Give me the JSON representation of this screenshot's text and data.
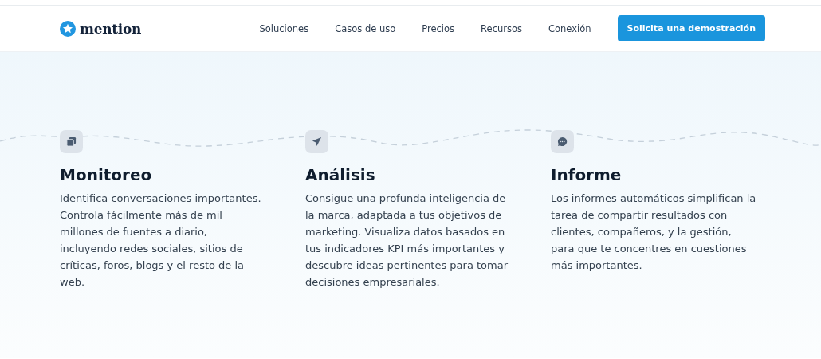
{
  "header": {
    "logo": "mention",
    "nav": [
      "Soluciones",
      "Casos de uso",
      "Precios",
      "Recursos",
      "Conexión"
    ],
    "cta": "Solicita una demostración"
  },
  "features": [
    {
      "title": "Monitoreo",
      "text": "Identifica conversaciones importantes. Controla fácilmente más de mil millones de fuentes a diario, incluyendo redes sociales, sitios de críticas, foros, blogs y el resto de la web."
    },
    {
      "title": "Análisis",
      "text": "Consigue una profunda inteligencia de la marca, adaptada a tus objetivos de marketing. Visualiza datos basados en tus indicadores KPI más importantes y descubre ideas pertinentes para tomar decisiones empresariales."
    },
    {
      "title": "Informe",
      "text": "Los informes automáticos simplifican la tarea de compartir resultados con clientes, compañeros, y la gestión, para que te concentres en cuestiones más importantes."
    }
  ]
}
